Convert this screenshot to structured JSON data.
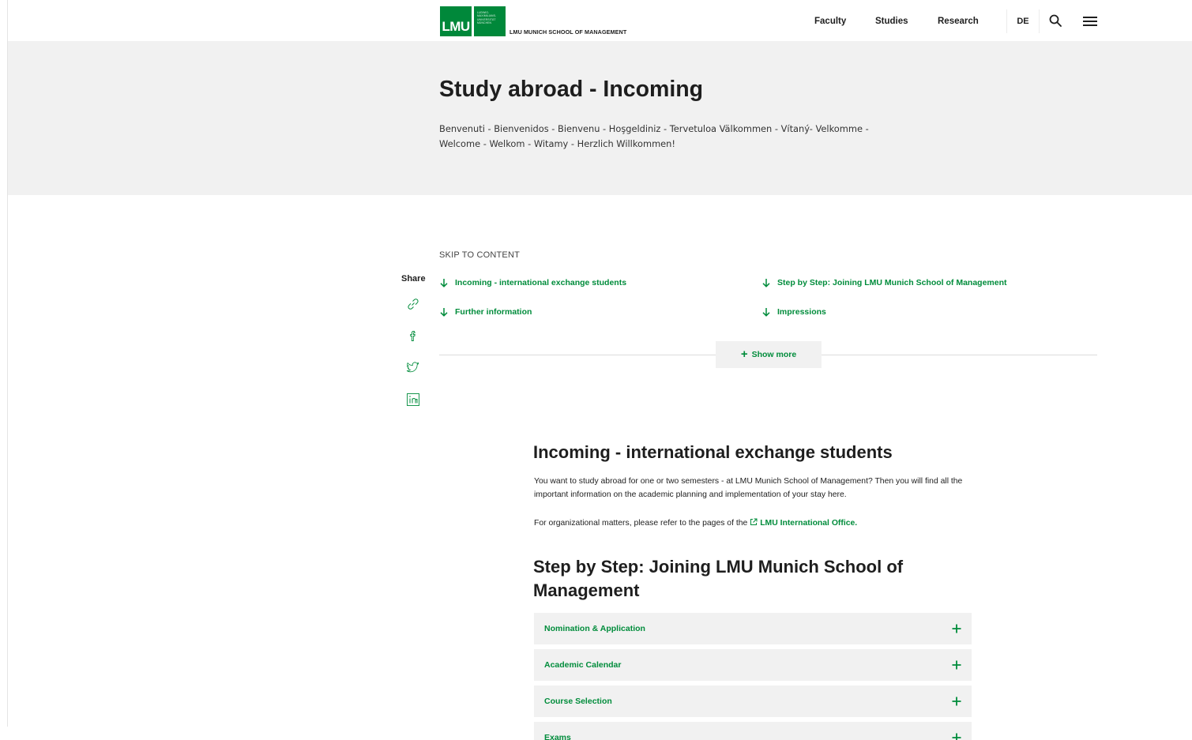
{
  "brand": {
    "logo_text": "LMU",
    "seal_lines": [
      "LUDWIG-",
      "MAXIMILIANS-",
      "UNIVERSITÄT",
      "MÜNCHEN"
    ],
    "school_name": "LMU MUNICH SCHOOL OF MANAGEMENT"
  },
  "nav": {
    "items": [
      {
        "label": "Faculty"
      },
      {
        "label": "Studies"
      },
      {
        "label": "Research"
      }
    ],
    "language": "DE",
    "search_icon": "search-icon",
    "menu_icon": "hamburger-menu-icon"
  },
  "hero": {
    "title": "Study abroad - Incoming",
    "greeting": "Benvenuti - Bienvenidos - Bienvenu - Hoşgeldiniz - Tervetuloa Välkommen - Vítaný- Velkomme - Welcome - Welkom - Witamy - Herzlich Willkommen!"
  },
  "jump_nav": {
    "skip_label": "SKIP TO CONTENT",
    "links": [
      {
        "label": "Incoming - international exchange students"
      },
      {
        "label": "Step by Step: Joining LMU Munich School of Management"
      },
      {
        "label": "Further information"
      },
      {
        "label": "Impressions"
      }
    ],
    "show_more": "Show more"
  },
  "share": {
    "label": "Share",
    "icons": [
      "link-icon",
      "facebook-icon",
      "twitter-icon",
      "linkedin-icon"
    ]
  },
  "content": {
    "section1_title": "Incoming - international exchange students",
    "section1_text": "You want to study abroad for one or two semesters - at LMU Munich School of Management? Then you will find all the important information on the academic planning and implementation of your stay here.",
    "section1_org_prefix": "For organizational matters, please refer to the pages of the",
    "section1_org_link": "LMU International Office.",
    "section2_title": "Step by Step: Joining LMU Munich School of Management",
    "accordion": [
      {
        "label": "Nomination & Application"
      },
      {
        "label": "Academic Calendar"
      },
      {
        "label": "Course Selection"
      },
      {
        "label": "Exams"
      }
    ]
  },
  "colors": {
    "brand_green": "#00883a",
    "link_green": "#008c3b",
    "panel_gray": "#f1f1f1"
  }
}
